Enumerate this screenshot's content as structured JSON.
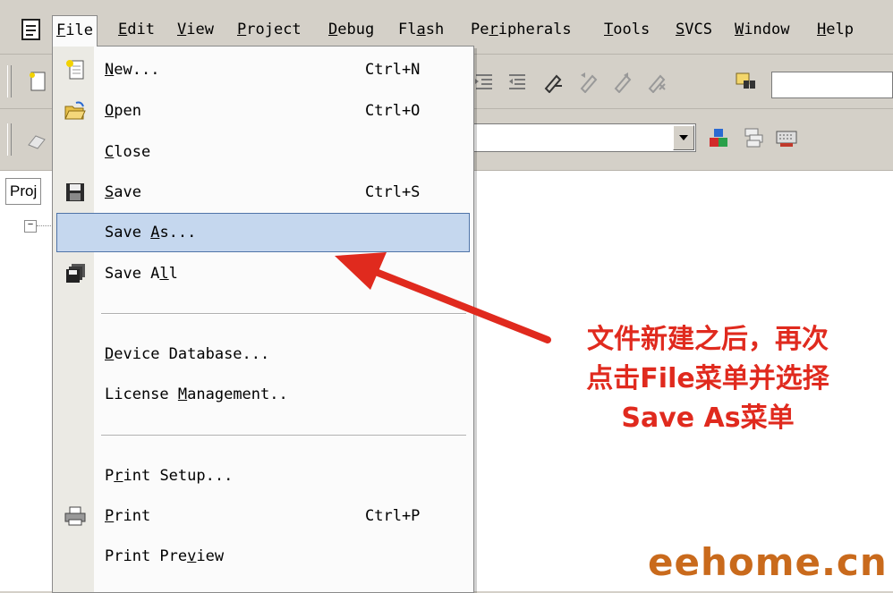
{
  "menubar": {
    "items": [
      {
        "label": "File",
        "mnemonic": "F",
        "rest": "ile"
      },
      {
        "label": "Edit",
        "mnemonic": "E",
        "rest": "dit"
      },
      {
        "label": "View",
        "mnemonic": "V",
        "rest": "iew"
      },
      {
        "label": "Project",
        "mnemonic": "P",
        "rest": "roject"
      },
      {
        "label": "Debug",
        "mnemonic": "D",
        "rest": "ebug"
      },
      {
        "label": "Flash",
        "pre": "Fl",
        "mnemonic": "a",
        "rest": "sh"
      },
      {
        "label": "Peripherals",
        "pre": "Pe",
        "mnemonic": "r",
        "rest": "ipherals"
      },
      {
        "label": "Tools",
        "mnemonic": "T",
        "rest": "ools"
      },
      {
        "label": "SVCS",
        "mnemonic": "S",
        "rest": "VCS"
      },
      {
        "label": "Window",
        "mnemonic": "W",
        "rest": "indow"
      },
      {
        "label": "Help",
        "mnemonic": "H",
        "rest": "elp"
      }
    ]
  },
  "project_pane": {
    "tab_label": "Proj"
  },
  "file_menu": {
    "new": {
      "pre": "",
      "mnemonic": "N",
      "rest": "ew...",
      "shortcut": "Ctrl+N"
    },
    "open": {
      "pre": "",
      "mnemonic": "O",
      "rest": "pen",
      "shortcut": "Ctrl+O"
    },
    "close": {
      "pre": "",
      "mnemonic": "C",
      "rest": "lose",
      "shortcut": ""
    },
    "save": {
      "pre": "",
      "mnemonic": "S",
      "rest": "ave",
      "shortcut": "Ctrl+S"
    },
    "save_as": {
      "pre": "Save ",
      "mnemonic": "A",
      "rest": "s...",
      "shortcut": ""
    },
    "save_all": {
      "pre": "Save A",
      "mnemonic": "l",
      "rest": "l",
      "shortcut": ""
    },
    "device_database": {
      "pre": "",
      "mnemonic": "D",
      "rest": "evice Database...",
      "shortcut": ""
    },
    "license_management": {
      "pre": "License ",
      "mnemonic": "M",
      "rest": "anagement..",
      "shortcut": ""
    },
    "print_setup": {
      "pre": "P",
      "mnemonic": "r",
      "rest": "int Setup...",
      "shortcut": ""
    },
    "print": {
      "pre": "",
      "mnemonic": "P",
      "rest": "rint",
      "shortcut": "Ctrl+P"
    },
    "print_preview": {
      "pre": "Print Pre",
      "mnemonic": "v",
      "rest": "iew",
      "shortcut": ""
    }
  },
  "annotation": {
    "line1": "文件新建之后，再次",
    "line2": "点击File菜单并选择",
    "line3": "Save As菜单",
    "color": "#e02a1e"
  },
  "watermark": {
    "text": "eehome.cn",
    "color": "#c96a1c"
  },
  "colors": {
    "highlight_bg": "#c5d7ee",
    "highlight_border": "#4f74a8",
    "chrome": "#d4d0c8"
  }
}
